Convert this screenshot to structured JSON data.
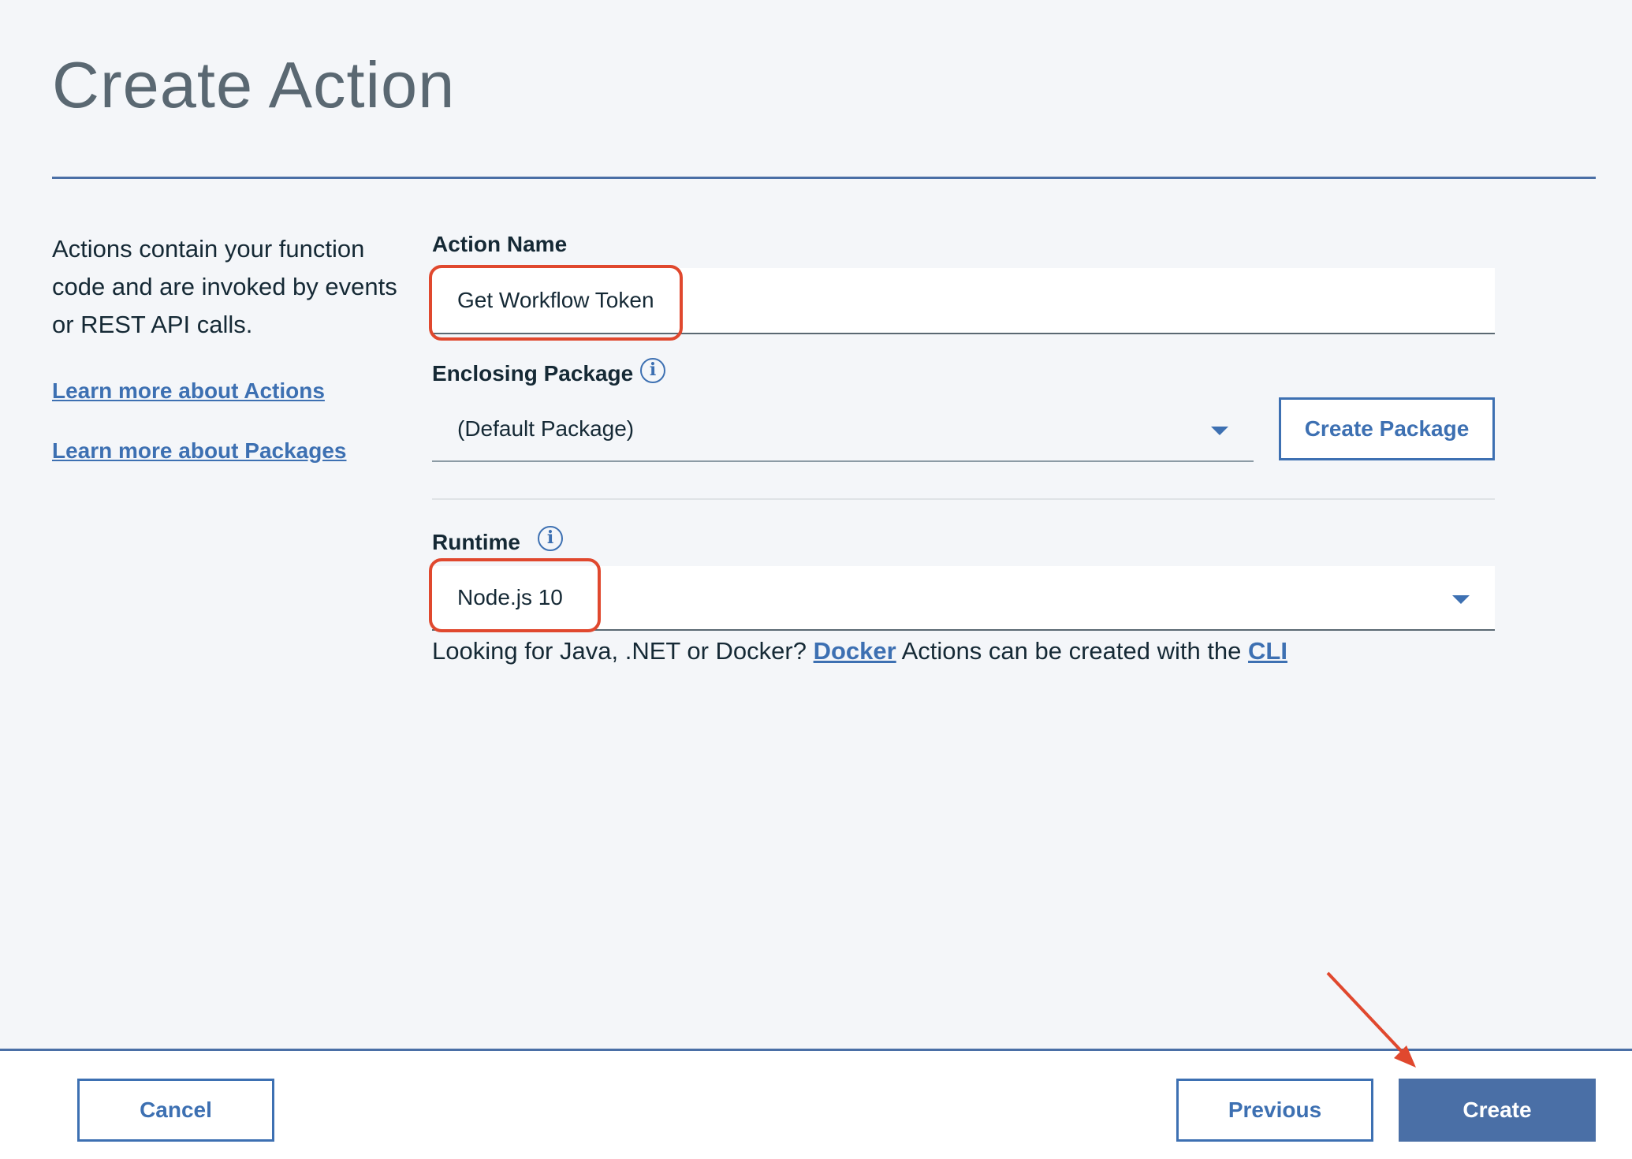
{
  "page": {
    "title": "Create Action",
    "description": "Actions contain your function code and are invoked by events or REST API calls.",
    "links": {
      "learn_actions": "Learn more about Actions",
      "learn_packages": "Learn more about Packages"
    }
  },
  "form": {
    "action_name": {
      "label": "Action Name",
      "value": "Get Workflow Token"
    },
    "enclosing_package": {
      "label": "Enclosing Package",
      "selected": "(Default Package)",
      "create_button": "Create Package"
    },
    "runtime": {
      "label": "Runtime",
      "selected": "Node.js 10"
    },
    "help": {
      "prefix": "Looking for Java, .NET or Docker? ",
      "docker_link": "Docker",
      "middle": " Actions can be created with the ",
      "cli_link": "CLI"
    }
  },
  "footer": {
    "cancel": "Cancel",
    "previous": "Previous",
    "create": "Create"
  },
  "colors": {
    "accent": "#3d70b2",
    "primary_button": "#4a6fa6",
    "annotation": "#e0482e"
  },
  "icons": {
    "info": "info-circle-icon",
    "dropdown": "caret-down-icon"
  }
}
